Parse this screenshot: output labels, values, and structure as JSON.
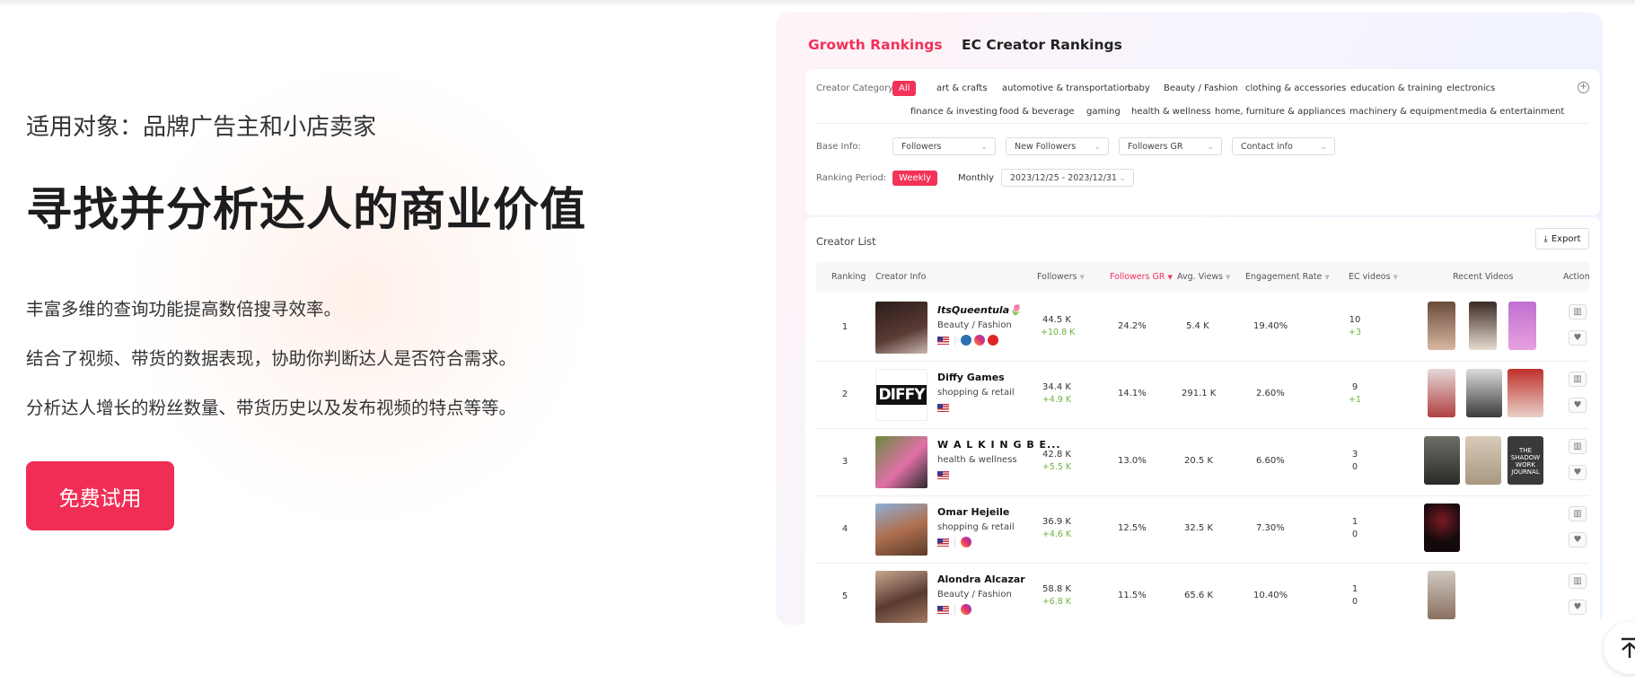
{
  "hero": {
    "subtitle": "适用对象：品牌广告主和小店卖家",
    "headline": "寻找并分析达人的商业价值",
    "features": [
      "丰富多维的查询功能提高数倍搜寻效率。",
      "结合了视频、带货的数据表现，协助你判断达人是否符合需求。",
      "分析达人增长的粉丝数量、带货历史以及发布视频的特点等等。"
    ],
    "cta_label": "免费试用",
    "accent_color": "#f02e55"
  },
  "panel": {
    "tabs": [
      "Growth Rankings",
      "EC Creator Rankings"
    ],
    "filters": {
      "category_label": "Creator Category:",
      "categories_row1": [
        "All",
        "art & crafts",
        "automotive & transportation",
        "baby",
        "Beauty / Fashion",
        "clothing & accessories",
        "education & training",
        "electronics"
      ],
      "categories_row2": [
        "finance & investing",
        "food & beverage",
        "gaming",
        "health & wellness",
        "home, furniture & appliances",
        "machinery & equipment",
        "media & entertainment"
      ],
      "base_info_label": "Base Info:",
      "base_info_selects": [
        "Followers",
        "New Followers",
        "Followers GR",
        "Contact info"
      ],
      "period_label": "Ranking Period:",
      "periods": [
        "Weekly",
        "Monthly"
      ],
      "date_range": "2023/12/25 - 2023/12/31"
    },
    "list": {
      "title": "Creator List",
      "export_label": "Export",
      "columns": [
        "Ranking",
        "Creator Info",
        "Followers",
        "Followers GR",
        "Avg. Views",
        "Engagement Rate",
        "EC videos",
        "Recent Videos",
        "Action"
      ],
      "rows": [
        {
          "rank": "1",
          "name": "ItsQueentula🌷",
          "category": "Beauty / Fashion",
          "followers": "44.5 K",
          "new_followers": "+10.8 K",
          "gr": "24.2%",
          "views": "5.4 K",
          "er": "19.40%",
          "ec": "10",
          "ec_new": "+3"
        },
        {
          "rank": "2",
          "name": "Diffy Games",
          "category": "shopping & retail",
          "followers": "34.4 K",
          "new_followers": "+4.9 K",
          "gr": "14.1%",
          "views": "291.1 K",
          "er": "2.60%",
          "ec": "9",
          "ec_new": "+1",
          "logo_text": "DIFFY"
        },
        {
          "rank": "3",
          "name": "W A L K I N G B E...",
          "category": "health & wellness",
          "followers": "42.8 K",
          "new_followers": "+5.5 K",
          "gr": "13.0%",
          "views": "20.5 K",
          "er": "6.60%",
          "ec": "3",
          "ec_new": "0",
          "thumb_text": "THE SHADOW WORK JOURNAL"
        },
        {
          "rank": "4",
          "name": "Omar Hejeile",
          "category": "shopping & retail",
          "followers": "36.9 K",
          "new_followers": "+4.6 K",
          "gr": "12.5%",
          "views": "32.5 K",
          "er": "7.30%",
          "ec": "1",
          "ec_new": "0"
        },
        {
          "rank": "5",
          "name": "Alondra Alcazar",
          "category": "Beauty / Fashion",
          "followers": "58.8 K",
          "new_followers": "+6.8 K",
          "gr": "11.5%",
          "views": "65.6 K",
          "er": "10.40%",
          "ec": "1",
          "ec_new": "0"
        }
      ]
    }
  }
}
